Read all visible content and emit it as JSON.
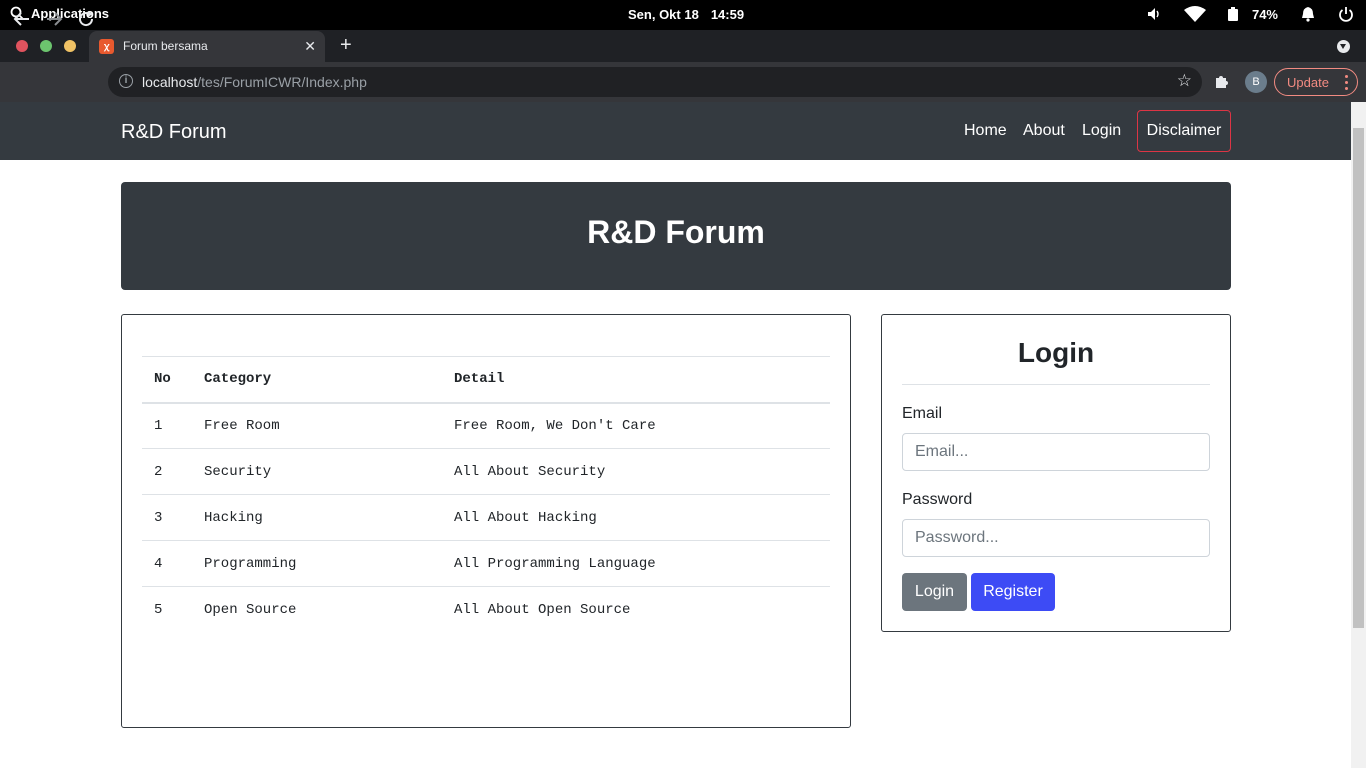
{
  "os": {
    "apps_label": "Applications",
    "date": "Sen, Okt 18",
    "time": "14:59",
    "battery": "74%"
  },
  "browser": {
    "tab_title": "Forum bersama",
    "tab_favicon": "xampp-icon",
    "url_host": "localhost",
    "url_path": "/tes/ForumICWR/Index.php",
    "profile_initial": "B",
    "update_label": "Update"
  },
  "site": {
    "brand": "R&D Forum",
    "nav": {
      "home": "Home",
      "about": "About",
      "login": "Login",
      "disclaimer": "Disclaimer"
    },
    "hero_title": "R&D Forum",
    "table": {
      "headers": [
        "No",
        "Category",
        "Detail"
      ],
      "rows": [
        [
          "1",
          "Free Room",
          "Free Room, We Don't Care"
        ],
        [
          "2",
          "Security",
          "All About Security"
        ],
        [
          "3",
          "Hacking",
          "All About Hacking"
        ],
        [
          "4",
          "Programming",
          "All Programming Language"
        ],
        [
          "5",
          "Open Source",
          "All About Open Source"
        ]
      ]
    },
    "login": {
      "title": "Login",
      "email_label": "Email",
      "email_placeholder": "Email...",
      "password_label": "Password",
      "password_placeholder": "Password...",
      "login_button": "Login",
      "register_button": "Register"
    }
  },
  "colors": {
    "navbar_bg": "#343a40",
    "disclaimer_border": "#dc3545",
    "register_btn": "#3d4bf5",
    "login_btn": "#6c757d"
  }
}
